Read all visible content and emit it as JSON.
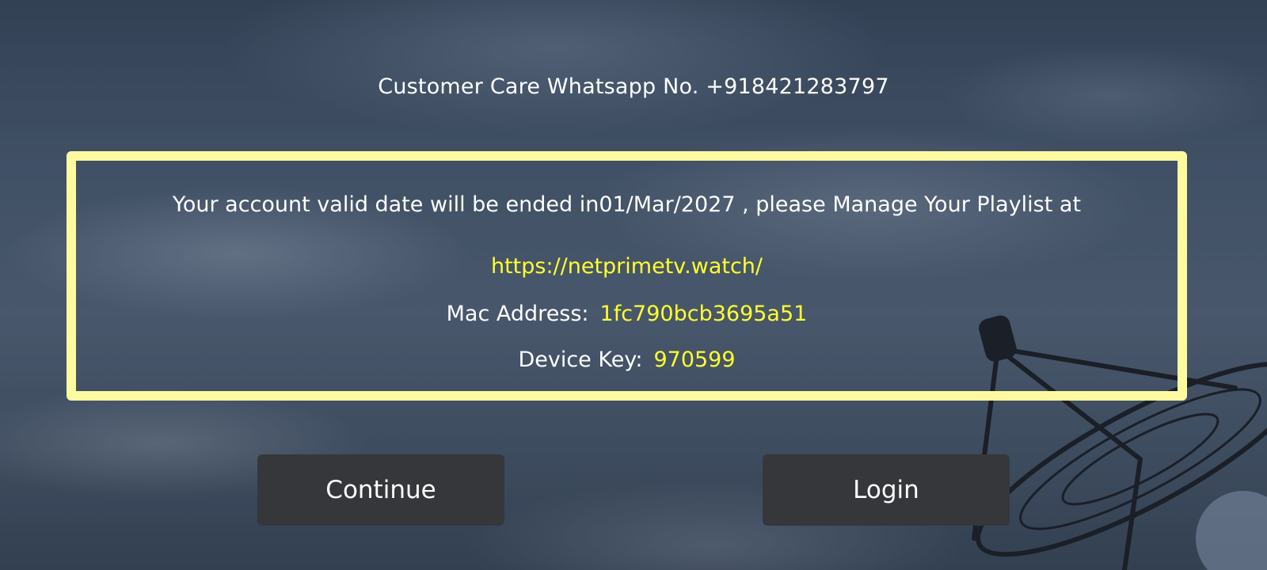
{
  "header": {
    "customer_care": "Customer Care Whatsapp No. +918421283797"
  },
  "account": {
    "validity_message": "Your account valid date will be ended in01/Mar/2027 , please Manage Your Playlist at",
    "playlist_url": "https://netprimetv.watch/",
    "mac_label": "Mac Address:",
    "mac_value": "1fc790bcb3695a51",
    "device_key_label": "Device Key:",
    "device_key_value": "970599"
  },
  "buttons": {
    "continue_label": "Continue",
    "login_label": "Login"
  },
  "colors": {
    "box_border": "#fffaa0",
    "highlight_text": "#ffff2e",
    "button_bg": "#35373a"
  }
}
